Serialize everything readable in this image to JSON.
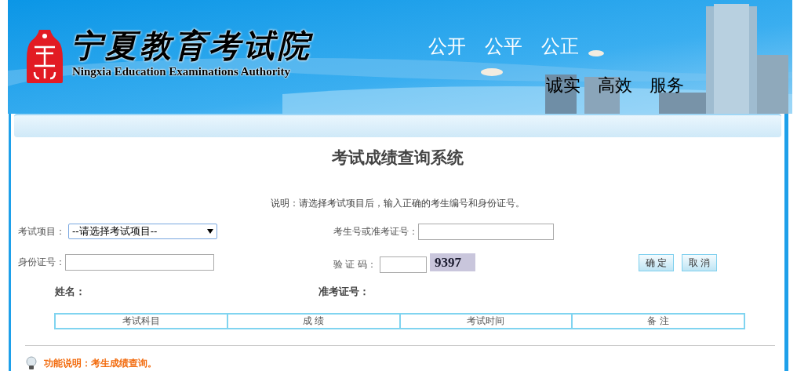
{
  "header": {
    "title": "宁夏教育考试院",
    "subtitle": "Ningxia Education Examinations Authority",
    "slogans": [
      "公开",
      "公平",
      "公正"
    ],
    "mottos": [
      "诚实",
      "高效",
      "服务"
    ]
  },
  "page_title": "考试成绩查询系统",
  "note": "说明：请选择考试项目后，输入正确的考生编号和身份证号。",
  "form": {
    "exam_project": {
      "label": "考试项目：",
      "value": "--请选择考试项目--"
    },
    "candidate_no": {
      "label": "考生号或准考证号："
    },
    "id_no": {
      "label": "身份证号："
    },
    "captcha": {
      "label": "验 证 码：",
      "code": "9397"
    },
    "buttons": [
      "确 定",
      "取 消"
    ]
  },
  "result": {
    "name_label": "姓名：",
    "ticket_label": "准考证号：",
    "columns": [
      "考试科目",
      "成 绩",
      "考试时间",
      "备 注"
    ]
  },
  "footer_note": "功能说明：考生成绩查询。"
}
